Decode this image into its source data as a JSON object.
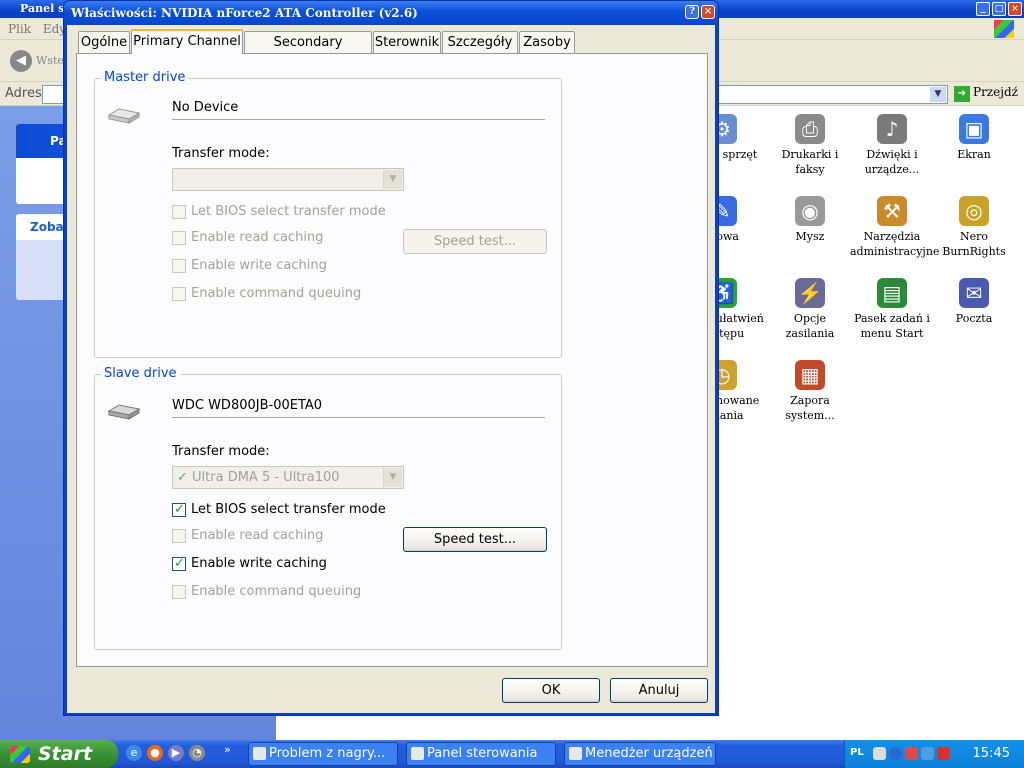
{
  "background_window": {
    "title": "Panel sterowania",
    "menu": [
      "Plik",
      "Edycja"
    ],
    "back_label": "Wstecz",
    "address_label": "Adres",
    "go_label": "Przejdź",
    "left_pane": {
      "panel1_title": "Panel sterowania",
      "panel2_title": "Zobacz też"
    },
    "icons": [
      {
        "label": "Dodaj sprzęt",
        "icon": "hardware-icon",
        "color": "#6a8fd0"
      },
      {
        "label": "Drukarki i faksy",
        "icon": "printer-icon",
        "color": "#8a8a8a"
      },
      {
        "label": "Dźwięki i urządze...",
        "icon": "speaker-icon",
        "color": "#7a7a7a"
      },
      {
        "label": "Ekran",
        "icon": "display-icon",
        "color": "#3a7ae0"
      },
      {
        "label": "Mowa",
        "icon": "speech-icon",
        "color": "#3a6ae0"
      },
      {
        "label": "Mysz",
        "icon": "mouse-icon",
        "color": "#9a9a9a"
      },
      {
        "label": "Narzędzia administracyjne",
        "icon": "admin-tools-icon",
        "color": "#c98a2a"
      },
      {
        "label": "Nero BurnRights",
        "icon": "nero-icon",
        "color": "#c9a22a"
      },
      {
        "label": "Opcje ułatwień dostępu",
        "icon": "accessibility-icon",
        "color": "#2aa03a"
      },
      {
        "label": "Opcje zasilania",
        "icon": "power-icon",
        "color": "#6a6a9a"
      },
      {
        "label": "Pasek zadań i menu Start",
        "icon": "taskbar-icon",
        "color": "#2a8a3a"
      },
      {
        "label": "Poczta",
        "icon": "mail-icon",
        "color": "#4a5ab0"
      },
      {
        "label": "Zaplanowane zadania",
        "icon": "scheduled-tasks-icon",
        "color": "#d0a030"
      },
      {
        "label": "Zapora system...",
        "icon": "firewall-icon",
        "color": "#c04a2a"
      }
    ]
  },
  "dialog": {
    "title": "Właściwości: NVIDIA nForce2 ATA Controller (v2.6)",
    "tabs": [
      {
        "label": "Ogólne",
        "active": false
      },
      {
        "label": "Primary Channel",
        "active": true
      },
      {
        "label": "Secondary Channel",
        "active": false
      },
      {
        "label": "Sterownik",
        "active": false
      },
      {
        "label": "Szczegóły",
        "active": false
      },
      {
        "label": "Zasoby",
        "active": false
      }
    ],
    "master": {
      "group_title": "Master drive",
      "device_name": "No Device",
      "transfer_label": "Transfer mode:",
      "transfer_value": "",
      "checkboxes": [
        {
          "label": "Let BIOS select transfer mode",
          "checked": false,
          "enabled": false
        },
        {
          "label": "Enable read caching",
          "checked": false,
          "enabled": false
        },
        {
          "label": "Enable write caching",
          "checked": false,
          "enabled": false
        },
        {
          "label": "Enable command queuing",
          "checked": false,
          "enabled": false
        }
      ],
      "speed_test": "Speed test..."
    },
    "slave": {
      "group_title": "Slave drive",
      "device_name": "WDC WD800JB-00ETA0",
      "transfer_label": "Transfer mode:",
      "transfer_value": "Ultra DMA 5 - Ultra100",
      "checkboxes": [
        {
          "label": "Let BIOS select transfer mode",
          "checked": true,
          "enabled": true
        },
        {
          "label": "Enable read caching",
          "checked": false,
          "enabled": false
        },
        {
          "label": "Enable write caching",
          "checked": true,
          "enabled": true
        },
        {
          "label": "Enable command queuing",
          "checked": false,
          "enabled": false
        }
      ],
      "speed_test": "Speed test..."
    },
    "ok_label": "OK",
    "cancel_label": "Anuluj"
  },
  "taskbar": {
    "start_label": "Start",
    "buttons": [
      {
        "label": "Problem z nagry..."
      },
      {
        "label": "Panel sterowania"
      },
      {
        "label": "Menedżer urządzeń"
      }
    ],
    "tray": {
      "language": "PL",
      "clock": "15:45"
    }
  }
}
